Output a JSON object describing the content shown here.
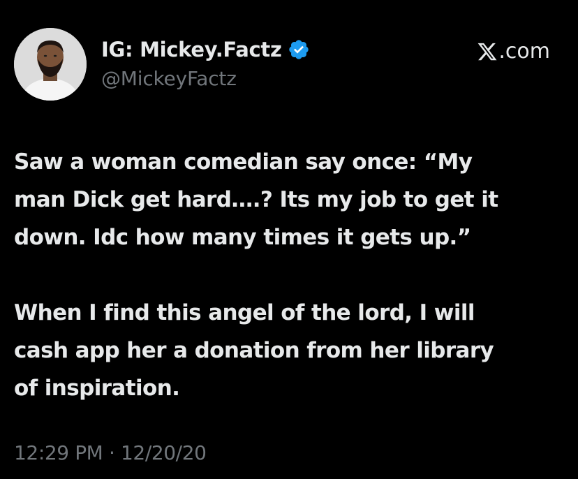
{
  "author": {
    "display_name": "IG: Mickey.Factz",
    "handle": "@MickeyFactz",
    "verified": true,
    "avatar_icon": "profile-photo"
  },
  "site": {
    "label": ".com",
    "logo_icon": "x-logo-icon"
  },
  "tweet": {
    "paragraphs": [
      {
        "lines": [
          "Saw a woman comedian say once: “My",
          "man Dick get hard….? Its my job to get it",
          "down. Idc how many times it gets up.”"
        ]
      },
      {
        "lines": [
          "When I find this angel of the lord, I will",
          "cash app her a donation from her library",
          "of inspiration."
        ]
      }
    ],
    "time": "12:29 PM",
    "separator": "·",
    "date": "12/20/20"
  },
  "colors": {
    "background": "#000000",
    "primary_text": "#e7e9ea",
    "secondary_text": "#71767b",
    "verified_badge": "#1d9bf0"
  }
}
